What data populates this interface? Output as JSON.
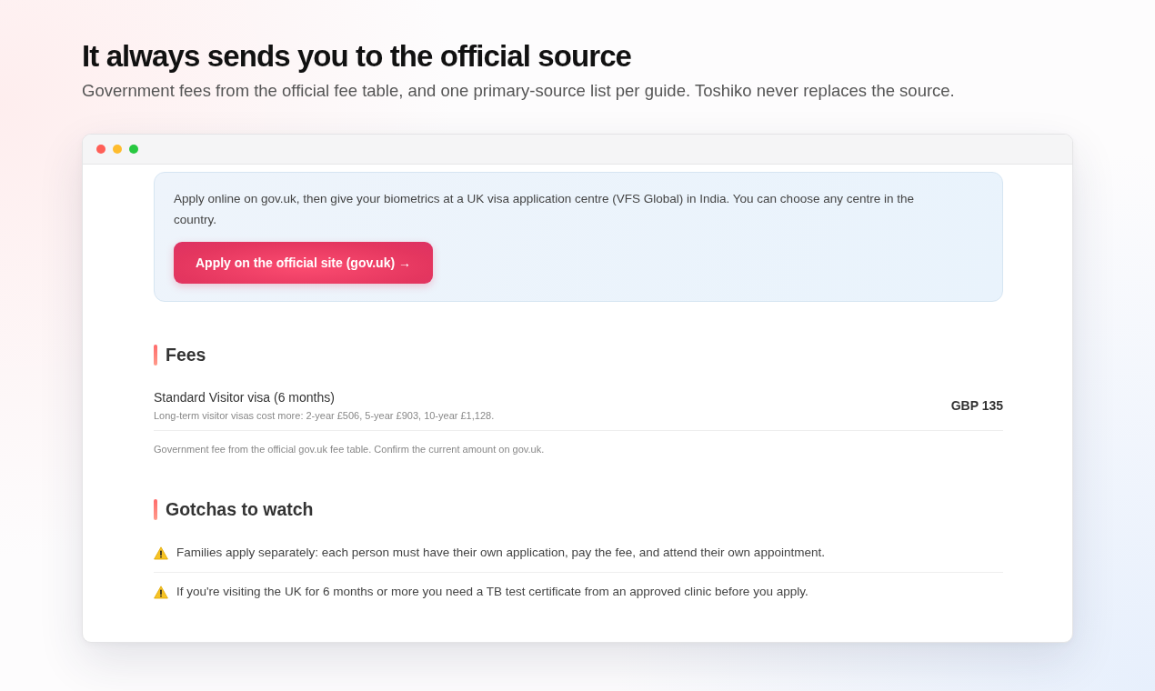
{
  "heading": {
    "title": "It always sends you to the official source",
    "subtitle": "Government fees from the official fee table, and one primary-source list per guide. Toshiko never replaces the source."
  },
  "apply_panel": {
    "text": "Apply online on gov.uk, then give your biometrics at a UK visa application centre (VFS Global) in India. You can choose any centre in the country.",
    "button": "Apply on the official site (gov.uk) →"
  },
  "fees": {
    "title": "Fees",
    "items": [
      {
        "name": "Standard Visitor visa (6 months)",
        "note": "Long-term visitor visas cost more: 2-year £506, 5-year £903, 10-year £1,128.",
        "amount": "GBP 135"
      }
    ],
    "footnote": "Government fee from the official gov.uk fee table. Confirm the current amount on gov.uk."
  },
  "gotchas": {
    "title": "Gotchas to watch",
    "items": [
      "Families apply separately: each person must have their own application, pay the fee, and attend their own appointment.",
      "If you're visiting the UK for 6 months or more you need a TB test certificate from an approved clinic before you apply."
    ]
  }
}
